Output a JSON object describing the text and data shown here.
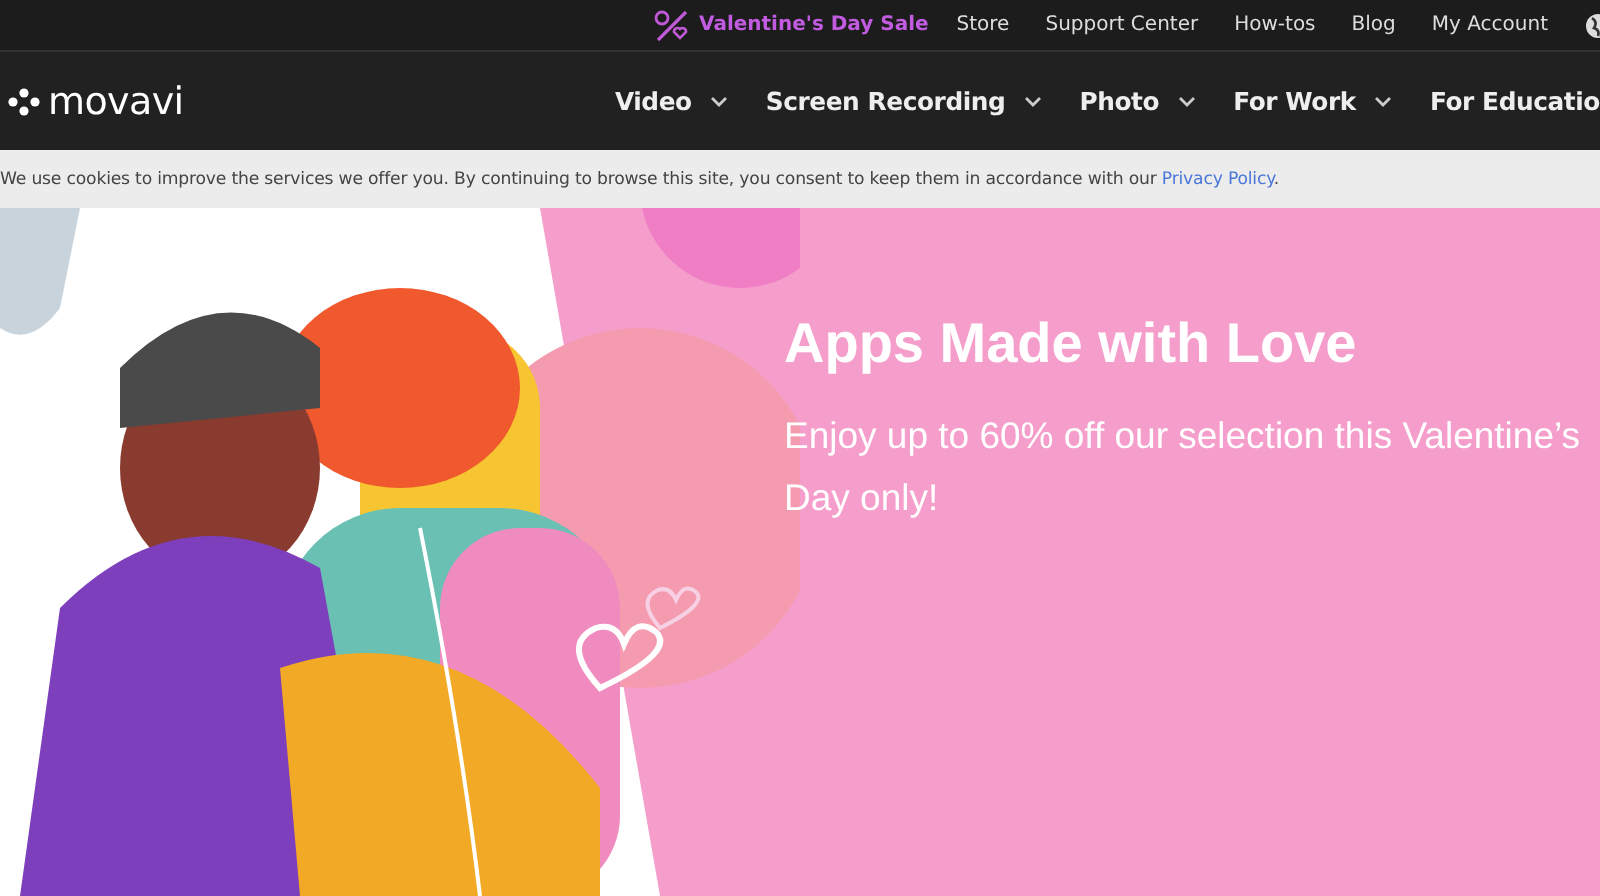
{
  "top_bar": {
    "sale": "Valentine's Day Sale",
    "links": [
      "Store",
      "Support Center",
      "How-tos",
      "Blog",
      "My Account"
    ]
  },
  "nav": {
    "logo": "movavi",
    "items": [
      {
        "label": "Video",
        "dropdown": true
      },
      {
        "label": "Screen Recording",
        "dropdown": true
      },
      {
        "label": "Photo",
        "dropdown": true
      },
      {
        "label": "For Work",
        "dropdown": true
      },
      {
        "label": "For Educatio",
        "dropdown": false
      }
    ]
  },
  "cookie_notice": {
    "text": "We use cookies to improve the services we offer you. By continuing to browse this site, you consent to keep them in accordance with our ",
    "link": "Privacy Policy",
    "end": "."
  },
  "hero": {
    "title": "Apps Made with Love",
    "subtitle": "Enjoy up to 60% off our selection this Valentine’s Day only!"
  }
}
